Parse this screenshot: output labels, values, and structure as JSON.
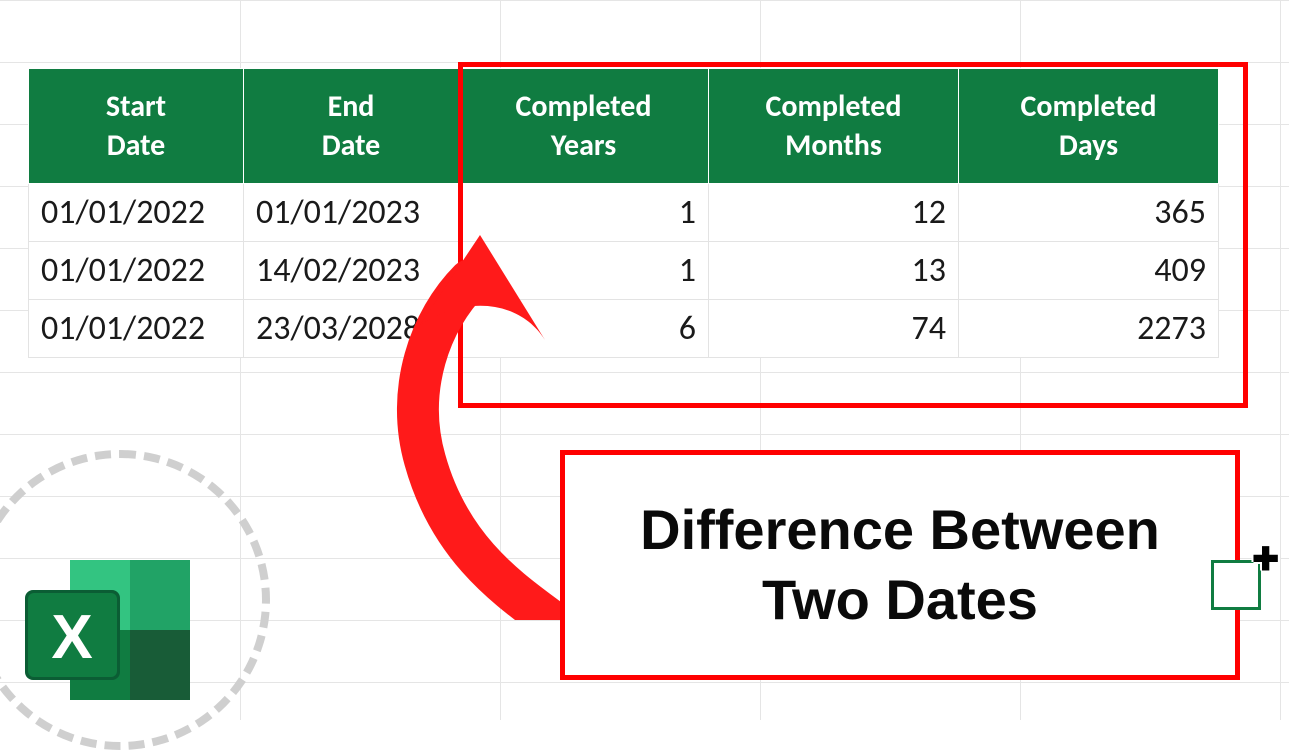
{
  "table": {
    "headers": [
      "Start Date",
      "End Date",
      "Completed Years",
      "Completed Months",
      "Completed Days"
    ],
    "rows": [
      {
        "start": "01/01/2022",
        "end": "01/01/2023",
        "years": "1",
        "months": "12",
        "days": "365"
      },
      {
        "start": "01/01/2022",
        "end": "14/02/2023",
        "years": "1",
        "months": "13",
        "days": "409"
      },
      {
        "start": "01/01/2022",
        "end": "23/03/2028",
        "years": "6",
        "months": "74",
        "days": "2273"
      }
    ]
  },
  "title": {
    "line1": "Difference Between",
    "line2": "Two Dates"
  },
  "icon": {
    "letter": "X"
  }
}
